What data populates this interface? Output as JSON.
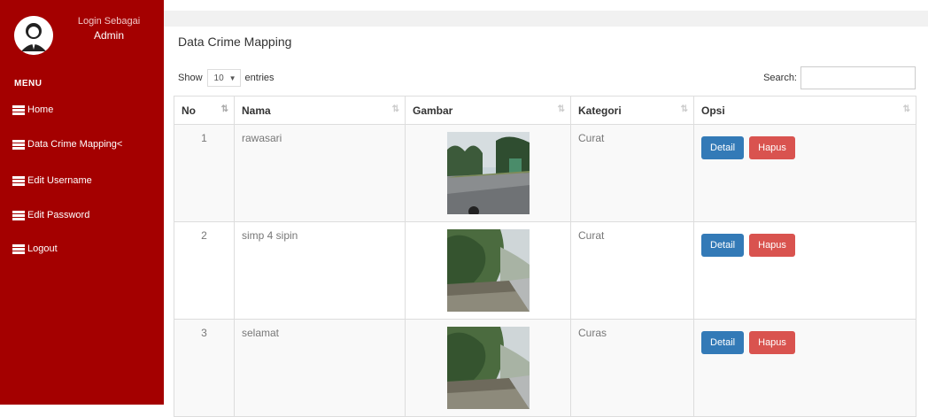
{
  "sidebar": {
    "login_label": "Login Sebagai",
    "login_user": "Admin",
    "menu_header": "MENU",
    "items": [
      {
        "label": "Home"
      },
      {
        "label": "Data Crime Mapping<"
      },
      {
        "label": "Edit Username"
      },
      {
        "label": "Edit Password"
      },
      {
        "label": "Logout"
      }
    ]
  },
  "main": {
    "title": "Data Crime Mapping",
    "show_label": "Show",
    "entries_value": "10",
    "entries_label": "entries",
    "search_label": "Search:",
    "search_value": ""
  },
  "table": {
    "headers": [
      "No",
      "Nama",
      "Gambar",
      "Kategori",
      "Opsi"
    ],
    "rows": [
      {
        "no": "1",
        "nama": "rawasari",
        "kategori": "Curat",
        "image": "road-photo"
      },
      {
        "no": "2",
        "nama": "simp 4 sipin",
        "kategori": "Curat",
        "image": "roadside-bushes-photo"
      },
      {
        "no": "3",
        "nama": "selamat",
        "kategori": "Curas",
        "image": "roadside-bushes-photo"
      }
    ],
    "detail_label": "Detail",
    "hapus_label": "Hapus"
  },
  "colors": {
    "sidebar": "#a40000",
    "detail_button": "#337ab7",
    "hapus_button": "#d9534f"
  }
}
